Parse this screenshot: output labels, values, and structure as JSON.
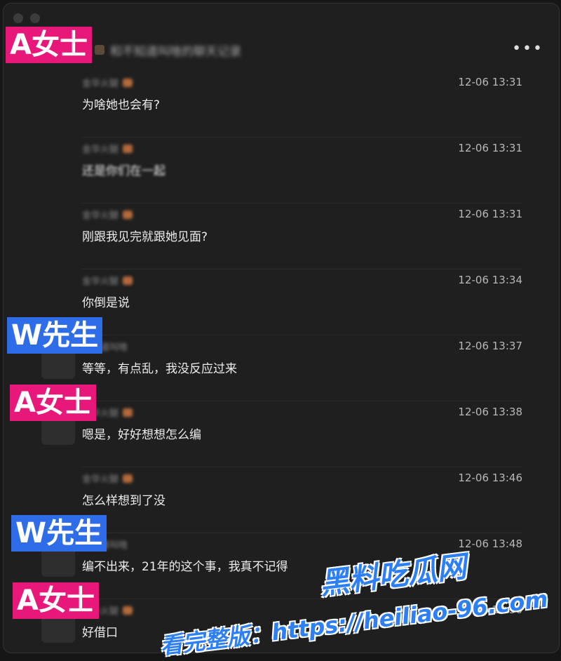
{
  "header": {
    "title": "和不知道叫啥的聊天记录",
    "more_icon": "more-dots-icon"
  },
  "messages": [
    {
      "sender": "金华火腿",
      "time": "12-06 13:31",
      "text": "为啥她也会有?",
      "blurred": false
    },
    {
      "sender": "金华火腿",
      "time": "12-06 13:31",
      "text": "还是你们在一起",
      "blurred": true
    },
    {
      "sender": "金华火腿",
      "time": "12-06 13:31",
      "text": "刚跟我见完就跟她见面?",
      "blurred": false
    },
    {
      "sender": "金华火腿",
      "time": "12-06 13:34",
      "text": "你倒是说",
      "blurred": false
    },
    {
      "sender": "不知道叫啥",
      "time": "12-06 13:37",
      "text": "等等，有点乱，我没反应过来",
      "blurred": false
    },
    {
      "sender": "金华火腿",
      "time": "12-06 13:38",
      "text": "嗯是，好好想想怎么编",
      "blurred": false
    },
    {
      "sender": "金华火腿",
      "time": "12-06 13:46",
      "text": "怎么样想到了没",
      "blurred": false
    },
    {
      "sender": "不知道叫啥",
      "time": "12-06 13:48",
      "text": "编不出来，21年的这个事，我真不记得",
      "blurred": false
    },
    {
      "sender": "金华火腿",
      "time": "12-06 13:50",
      "text": "好借口",
      "blurred": false
    }
  ],
  "labels": {
    "a": "A女士",
    "w": "W先生"
  },
  "watermark": {
    "logo": "黑料吃瓜网",
    "url": "看完整版：https://heiliao-96.com"
  },
  "colors": {
    "label_a": "#e8187a",
    "label_w": "#2f6de8",
    "watermark": "#2d7ff5"
  }
}
